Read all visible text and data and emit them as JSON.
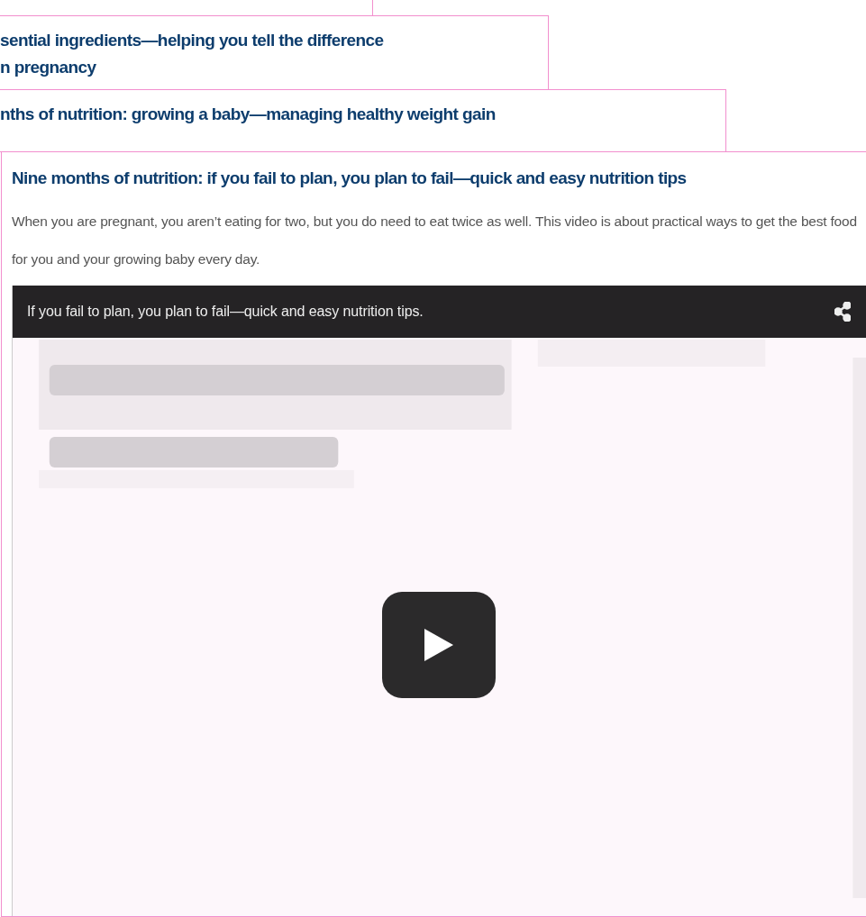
{
  "items": [
    {
      "title_lines": [
        "sential ingredients—helping you tell the difference",
        "n pregnancy"
      ],
      "expanded": false
    },
    {
      "title_lines": [
        "nths of nutrition: growing a baby—managing healthy weight gain"
      ],
      "expanded": false
    },
    {
      "title_lines": [
        "Nine months of nutrition: if you fail to plan, you plan to fail—quick and easy nutrition tips"
      ],
      "expanded": true,
      "description": "When you are pregnant, you aren’t eating for two, but you do need to eat twice as well. This video is about practical ways to get the best food for you and your growing baby every day.",
      "video": {
        "kind": "picture",
        "caption": "If you fail to plan, you plan to fail—quick and easy nutrition tips."
      }
    }
  ]
}
